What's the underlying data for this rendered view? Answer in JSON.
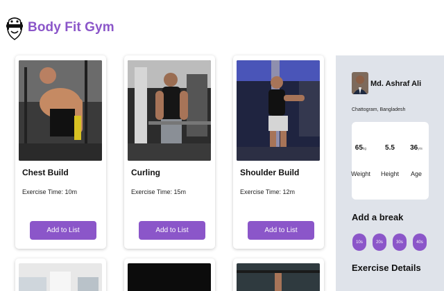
{
  "header": {
    "brand": "Body Fit Gym"
  },
  "cards": [
    {
      "title": "Chest Build",
      "time": "Exercise Time: 10m",
      "button": "Add to List",
      "photo": "chest-workout-photo"
    },
    {
      "title": "Curling",
      "time": "Exercise Time: 15m",
      "button": "Add to List",
      "photo": "curling-workout-photo"
    },
    {
      "title": "Shoulder Build",
      "time": "Exercise Time: 12m",
      "button": "Add to List",
      "photo": "shoulder-workout-photo"
    }
  ],
  "profile": {
    "name": "Md. Ashraf Ali",
    "location": "Chattogram, Bangladesh",
    "stats": [
      {
        "value": "65",
        "unit": "kg",
        "label": "Weight"
      },
      {
        "value": "5.5",
        "unit": "",
        "label": "Height"
      },
      {
        "value": "36",
        "unit": "yrs",
        "label": "Age"
      }
    ]
  },
  "break": {
    "title": "Add a break",
    "options": [
      "10s",
      "20s",
      "30s",
      "40s"
    ]
  },
  "details": {
    "title": "Exercise Details"
  },
  "colors": {
    "accent": "#8b56c9",
    "sidebar": "#dfe3ea"
  }
}
